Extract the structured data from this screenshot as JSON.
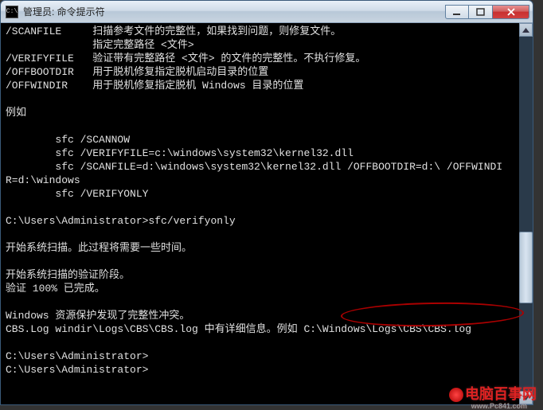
{
  "window": {
    "title": "管理员: 命令提示符",
    "icon_text": "C:\\"
  },
  "console": {
    "lines": [
      "/SCANFILE     扫描参考文件的完整性，如果找到问题，则修复文件。",
      "              指定完整路径 <文件>",
      "/VERIFYFILE   验证带有完整路径 <文件> 的文件的完整性。不执行修复。",
      "/OFFBOOTDIR   用于脱机修复指定脱机启动目录的位置",
      "/OFFWINDIR    用于脱机修复指定脱机 Windows 目录的位置",
      "",
      "例如",
      "",
      "        sfc /SCANNOW",
      "        sfc /VERIFYFILE=c:\\windows\\system32\\kernel32.dll",
      "        sfc /SCANFILE=d:\\windows\\system32\\kernel32.dll /OFFBOOTDIR=d:\\ /OFFWINDI",
      "R=d:\\windows",
      "        sfc /VERIFYONLY",
      "",
      "C:\\Users\\Administrator>sfc/verifyonly",
      "",
      "开始系统扫描。此过程将需要一些时间。",
      "",
      "开始系统扫描的验证阶段。",
      "验证 100% 已完成。",
      "",
      "Windows 资源保护发现了完整性冲突。",
      "CBS.Log windir\\Logs\\CBS\\CBS.log 中有详细信息。例如 C:\\Windows\\Logs\\CBS\\CBS.log",
      "",
      "C:\\Users\\Administrator>",
      "C:\\Users\\Administrator>"
    ]
  },
  "watermark": {
    "text": "电脑百事网",
    "url": "www.Pc841.com"
  }
}
